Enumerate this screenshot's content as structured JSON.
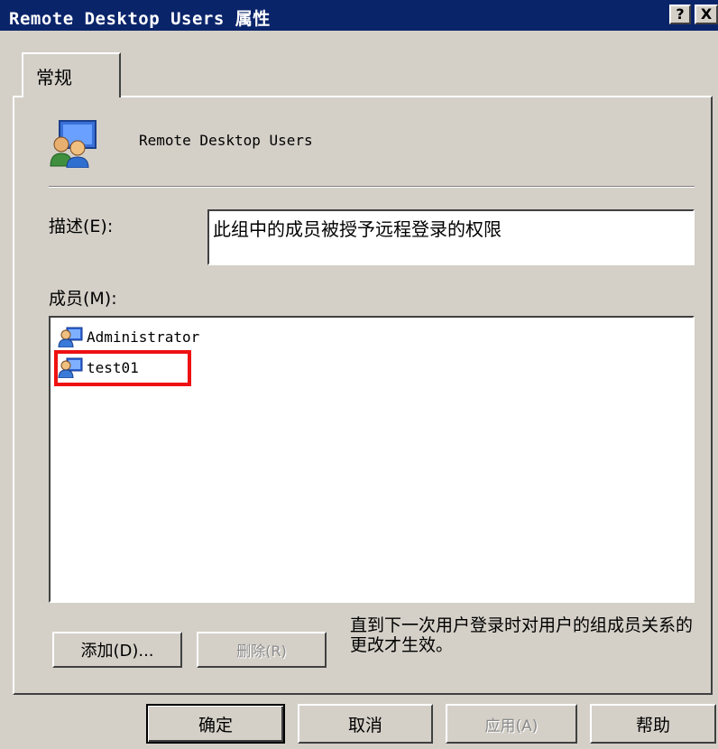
{
  "window": {
    "title": "Remote Desktop Users 属性",
    "help_glyph": "?",
    "close_glyph": "X"
  },
  "tabs": [
    {
      "label": "常规",
      "selected": true
    }
  ],
  "group": {
    "icon": "users-group-icon",
    "name": "Remote Desktop Users"
  },
  "description": {
    "label": "描述(E):",
    "value": "此组中的成员被授予远程登录的权限"
  },
  "members": {
    "label": "成员(M):",
    "items": [
      {
        "name": "Administrator",
        "icon": "user-icon"
      },
      {
        "name": "test01",
        "icon": "user-icon",
        "highlighted": true
      }
    ]
  },
  "member_actions": {
    "add_label": "添加(D)...",
    "remove_label": "删除(R)",
    "remove_enabled": false
  },
  "note": "直到下一次用户登录时对用户的组成员关系的更改才生效。",
  "footer": {
    "ok_label": "确定",
    "cancel_label": "取消",
    "apply_label": "应用(A)",
    "help_label": "帮助",
    "apply_enabled": false
  },
  "colors": {
    "titlebar": "#0a246a",
    "face": "#d4d0c8",
    "highlight_box": "#ee1111"
  }
}
